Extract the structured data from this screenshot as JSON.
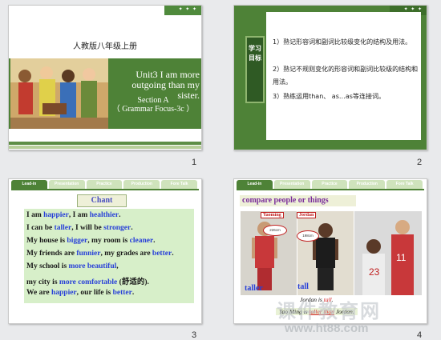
{
  "slide1": {
    "number": "1",
    "book": "人教版八年级上册",
    "title_line1": "Unit3 I am more",
    "title_line2": "outgoing than my sister.",
    "section": "Section A",
    "subsection": "（ Grammar Focus-3c ）"
  },
  "slide2": {
    "number": "2",
    "label": "学习目标",
    "items": [
      "1）熟记形容词和副词比较级变化的结构及用法。",
      "2）熟记不规则变化的形容词和副词比较级的结构和用法。",
      "3）熟练运用than、 as…as等连接词。"
    ]
  },
  "tabs": [
    "Lead-in",
    "Presentation",
    "Practice",
    "Production",
    "Fore Talk"
  ],
  "slide3": {
    "number": "3",
    "heading": "Chant",
    "lines": [
      {
        "a": "I am ",
        "b": "happier",
        "c": ", I am ",
        "d": "healthier",
        "e": "."
      },
      {
        "a": "I can be ",
        "b": "taller",
        "c": ", I will be ",
        "d": "stronger",
        "e": "."
      },
      {
        "a": "My house is ",
        "b": "bigger",
        "c": ", my room is ",
        "d": "cleaner",
        "e": "."
      },
      {
        "a": "My friends are ",
        "b": "funnier",
        "c": ", my grades are ",
        "d": "better",
        "e": "."
      },
      {
        "a": "My school is ",
        "b": "more beautiful",
        "c": ",",
        "d": "",
        "e": ""
      },
      {
        "a": "my city is ",
        "b": "more comfortable",
        "c": " (舒适的).",
        "d": "",
        "e": ""
      },
      {
        "a": "We are ",
        "b": "happier",
        "c": ", our life is ",
        "d": "better",
        "e": "."
      }
    ]
  },
  "slide4": {
    "number": "4",
    "heading": "compare people or things",
    "name1": "Yaoming",
    "name2": "Jordan",
    "height1": "226cm",
    "height2": "198cm",
    "word1": "taller",
    "word2": "tall",
    "caption1_a": "Jordan is ",
    "caption1_b": "tall",
    "caption1_c": ".",
    "caption2_a": "Yao Ming  is  ",
    "caption2_b": "taller than",
    "caption2_c": "  Jordan."
  },
  "watermark": {
    "line1": "课件教育网",
    "line2": "www.ht88.com"
  },
  "colors": {
    "green": "#4e8237",
    "blue": "#2840d8",
    "red": "#d42020",
    "purple": "#7a2d9a"
  }
}
